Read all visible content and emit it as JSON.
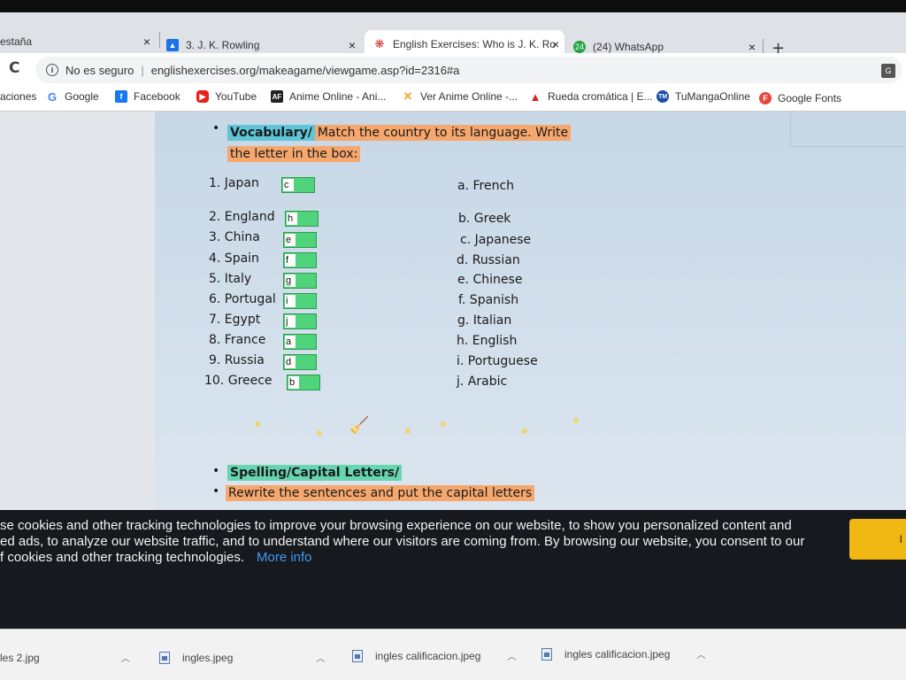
{
  "browser": {
    "tabs": [
      {
        "title": "estaña",
        "close": "×"
      },
      {
        "title": "3. J. K. Rowling",
        "close": "×"
      },
      {
        "title": "English Exercises: Who is J. K. Ro",
        "close": "×"
      },
      {
        "title": "(24) WhatsApp",
        "close": "×"
      }
    ],
    "new_tab": "+",
    "address": {
      "security_label": "No es seguro",
      "url": "englishexercises.org/makeagame/viewgame.asp?id=2316#a"
    },
    "bookmarks": [
      {
        "label": "aciones",
        "icon": "apps-icon"
      },
      {
        "label": "Google",
        "icon": "google-icon"
      },
      {
        "label": "Facebook",
        "icon": "facebook-icon"
      },
      {
        "label": "YouTube",
        "icon": "youtube-icon"
      },
      {
        "label": "Anime Online - Ani...",
        "icon": "af-icon"
      },
      {
        "label": "Ver Anime Online -...",
        "icon": "jk-icon"
      },
      {
        "label": "Rueda cromática | E...",
        "icon": "adobe-icon"
      },
      {
        "label": "TuMangaOnline",
        "icon": "tmo-icon"
      },
      {
        "label": "Google Fonts",
        "icon": "fonts-icon"
      }
    ]
  },
  "exercise": {
    "section1_label": "Vocabulary/",
    "section1_instruction_a": "Match the country to its language. Write",
    "section1_instruction_b": "the letter in the box:",
    "countries": [
      {
        "label": "1. Japan",
        "answer": "c"
      },
      {
        "label": "2. England",
        "answer": "h"
      },
      {
        "label": "3. China",
        "answer": "e"
      },
      {
        "label": "4. Spain",
        "answer": "f"
      },
      {
        "label": "5. Italy",
        "answer": "g"
      },
      {
        "label": "6. Portugal",
        "answer": "i"
      },
      {
        "label": "7. Egypt",
        "answer": "j"
      },
      {
        "label": "8. France",
        "answer": "a"
      },
      {
        "label": "9. Russia",
        "answer": "d"
      },
      {
        "label": "10. Greece",
        "answer": "b"
      }
    ],
    "languages": [
      "a. French",
      "b. Greek",
      "c. Japanese",
      "d. Russian",
      "e. Chinese",
      "f. Spanish",
      "g. Italian",
      "h. English",
      "i. Portuguese",
      "j.  Arabic"
    ],
    "section2_label": "Spelling/Capital Letters/",
    "section2_instruction": "Rewrite the sentences and put the capital letters"
  },
  "cookie_banner": {
    "line1": "se cookies and other tracking technologies to improve your browsing experience on our website, to show you personalized content and",
    "line2": "ed ads, to analyze our website traffic, and to understand where our visitors are coming from. By browsing our website, you consent to our",
    "line3": "f cookies and other tracking technologies.",
    "more_info": "More info",
    "button": "I"
  },
  "downloads": [
    {
      "name": "les 2.jpg"
    },
    {
      "name": "ingles.jpeg"
    },
    {
      "name": "ingles calificacion.jpeg"
    },
    {
      "name": "ingles calificacion.jpeg"
    }
  ],
  "colors": {
    "highlight_blue": "#5ec6d8",
    "highlight_orange": "#f6a76d",
    "answer_box_green": "#4fd37b",
    "cookie_bg": "#16191d",
    "cookie_button": "#f1b814",
    "link_blue": "#3d9bf2"
  }
}
